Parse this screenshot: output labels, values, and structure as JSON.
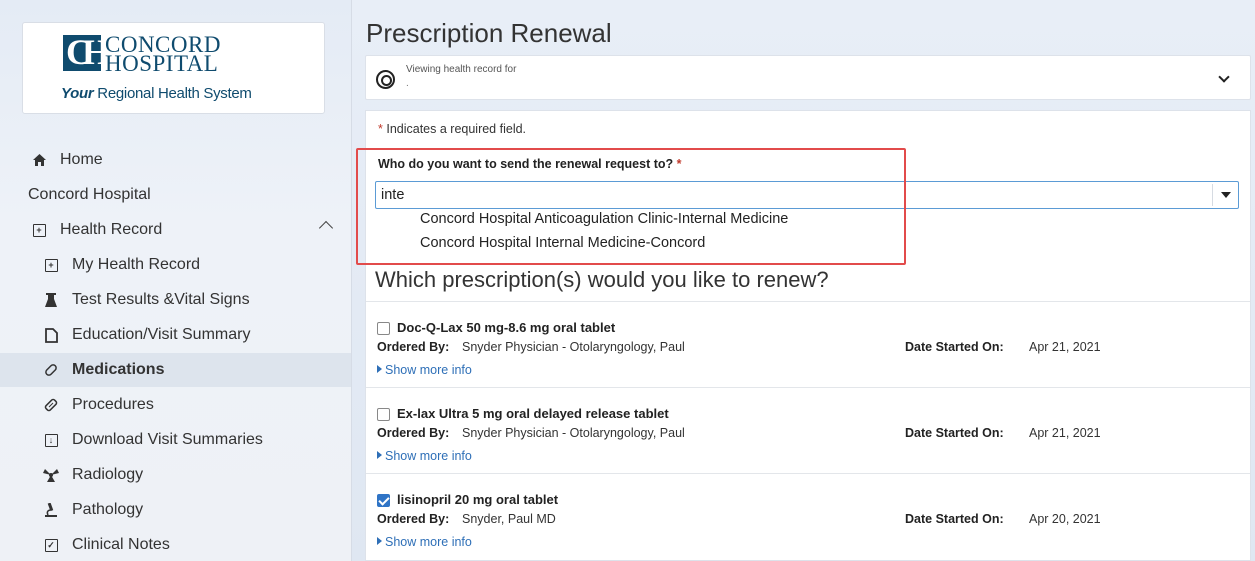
{
  "logo": {
    "mark_c": "C",
    "mark_h": "H",
    "name_line1": "CONCORD",
    "name_line2": "HOSPITAL",
    "tagline_bold": "Your",
    "tagline_rest": " Regional Health System"
  },
  "sidebar": {
    "home": "Home",
    "org": "Concord Hospital",
    "health_record": "Health Record",
    "items": [
      {
        "label": "My Health Record",
        "icon": "record-icon"
      },
      {
        "label": "Test Results &Vital Signs",
        "icon": "flask-icon"
      },
      {
        "label": "Education/Visit Summary",
        "icon": "document-icon"
      },
      {
        "label": "Medications",
        "icon": "pill-icon"
      },
      {
        "label": "Procedures",
        "icon": "procedure-icon"
      },
      {
        "label": "Download Visit Summaries",
        "icon": "download-icon"
      },
      {
        "label": "Radiology",
        "icon": "radiology-icon"
      },
      {
        "label": "Pathology",
        "icon": "microscope-icon"
      },
      {
        "label": "Clinical Notes",
        "icon": "notes-icon"
      }
    ],
    "active_item": "Medications"
  },
  "page": {
    "title": "Prescription Renewal",
    "viewing_label": "Viewing health record for",
    "viewing_sub": "."
  },
  "form": {
    "required_star": "*",
    "required_note": " Indicates a required field.",
    "question": "Who do you want to send the renewal request to?",
    "question_star": "*",
    "search_value": "inte",
    "options": [
      "Concord Hospital Anticoagulation Clinic-Internal Medicine",
      "Concord Hospital Internal Medicine-Concord"
    ],
    "section_title": "Which prescription(s) would you like to renew?"
  },
  "prescriptions": [
    {
      "name": "Doc-Q-Lax 50 mg-8.6 mg oral tablet",
      "checked": false,
      "ordered_by_label": "Ordered By:",
      "ordered_by": "Snyder Physician - Otolaryngology, Paul",
      "date_label": "Date Started On:",
      "date": "Apr 21, 2021",
      "more": "Show more info"
    },
    {
      "name": "Ex-lax Ultra 5 mg oral delayed release tablet",
      "checked": false,
      "ordered_by_label": "Ordered By:",
      "ordered_by": "Snyder Physician - Otolaryngology, Paul",
      "date_label": "Date Started On:",
      "date": "Apr 21, 2021",
      "more": "Show more info"
    },
    {
      "name": "lisinopril 20 mg oral tablet",
      "checked": true,
      "ordered_by_label": "Ordered By:",
      "ordered_by": "Snyder, Paul MD",
      "date_label": "Date Started On:",
      "date": "Apr 20, 2021",
      "more": "Show more info"
    }
  ],
  "colors": {
    "brand": "#0f4b6e",
    "link": "#2e6fb7",
    "highlight_box": "#e24b4b",
    "checkbox_checked": "#2f74c6"
  }
}
